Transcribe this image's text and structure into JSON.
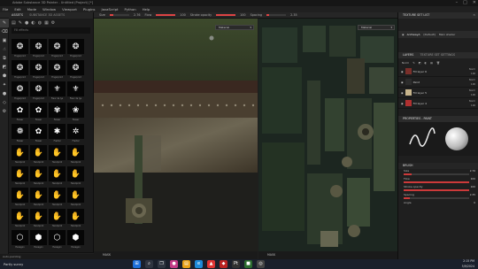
{
  "window": {
    "title": "Adobe Substance 3D Painter - Untitled (Project) [*]"
  },
  "menu": [
    "File",
    "Edit",
    "Mode",
    "Window",
    "Viewport",
    "Plugins",
    "JavaScript",
    "Python",
    "Help"
  ],
  "toolbar": {
    "size_label": "Size",
    "size_value": "2.76",
    "flow_label": "Flow",
    "flow_value": "100",
    "stroke_label": "Stroke opacity",
    "stroke_value": "100",
    "spacing_label": "Spacing",
    "spacing_value": "2.35"
  },
  "left_tools": [
    "paint",
    "eraser",
    "projection",
    "smudge",
    "clone",
    "fill",
    "polygon",
    "picker",
    "material",
    "geometry",
    "bake"
  ],
  "assets": {
    "tab_active": "ASSETS",
    "tab_other": "SUBSTANCE 3D ASSETS",
    "search_placeholder": "Fill effects",
    "items": [
      {
        "label": "Fingerprint",
        "glyph": "❂"
      },
      {
        "label": "Fingerprint",
        "glyph": "❂"
      },
      {
        "label": "Fingerprint",
        "glyph": "❂"
      },
      {
        "label": "Fingerprint",
        "glyph": "❂"
      },
      {
        "label": "Fingerprint",
        "glyph": "❂"
      },
      {
        "label": "Fingerprint",
        "glyph": "❂"
      },
      {
        "label": "Fingerprint",
        "glyph": "❂"
      },
      {
        "label": "Fingerprint",
        "glyph": "❂"
      },
      {
        "label": "Fingerprint",
        "glyph": "❂"
      },
      {
        "label": "Fingerprint",
        "glyph": "❂"
      },
      {
        "label": "Fleur de lys",
        "glyph": "⚜"
      },
      {
        "label": "Fleur de lys",
        "glyph": "⚜"
      },
      {
        "label": "Flower",
        "glyph": "✿"
      },
      {
        "label": "Flower",
        "glyph": "✿"
      },
      {
        "label": "Flower",
        "glyph": "✾"
      },
      {
        "label": "Flower",
        "glyph": "❀"
      },
      {
        "label": "Flower",
        "glyph": "❁"
      },
      {
        "label": "Flower",
        "glyph": "✿"
      },
      {
        "label": "Fractal",
        "glyph": "✱"
      },
      {
        "label": "Fractal",
        "glyph": "✲"
      },
      {
        "label": "Handprint",
        "glyph": "✋"
      },
      {
        "label": "Handprint",
        "glyph": "✋"
      },
      {
        "label": "Handprint",
        "glyph": "✋"
      },
      {
        "label": "Handprint",
        "glyph": "✋"
      },
      {
        "label": "Handprint",
        "glyph": "✋"
      },
      {
        "label": "Handprint",
        "glyph": "✋"
      },
      {
        "label": "Handprint",
        "glyph": "✋"
      },
      {
        "label": "Handprint",
        "glyph": "✋"
      },
      {
        "label": "Handprint",
        "glyph": "✋"
      },
      {
        "label": "Handprint",
        "glyph": "✋"
      },
      {
        "label": "Handprint",
        "glyph": "✋"
      },
      {
        "label": "Handprint",
        "glyph": "✋"
      },
      {
        "label": "Handprint",
        "glyph": "✋"
      },
      {
        "label": "Handprint",
        "glyph": "✋"
      },
      {
        "label": "Handprint",
        "glyph": "✋"
      },
      {
        "label": "Handprint",
        "glyph": "✋"
      },
      {
        "label": "Hexagon",
        "glyph": "⬡"
      },
      {
        "label": "Hexagon",
        "glyph": "⬢"
      },
      {
        "label": "Hexagon",
        "glyph": "⬡"
      },
      {
        "label": "Hexagon",
        "glyph": "⬢"
      }
    ]
  },
  "viewport3d": {
    "dropdown": "Material",
    "footer": "MASK"
  },
  "viewport2d": {
    "dropdown": "Material",
    "footer": "MASK"
  },
  "texture_set_list": {
    "title": "TEXTURE SET LIST",
    "item": "ArchwayA",
    "item_sub": "[Default]",
    "item_right": "Main shader"
  },
  "layers": {
    "tab_layers": "LAYERS",
    "tab_settings": "TEXTURE SET SETTINGS",
    "blend_default": "Norm",
    "items": [
      {
        "name": "Fill layer 6",
        "blend": "Norm",
        "opacity": "100",
        "color": "#7a2f2a"
      },
      {
        "name": "Paint",
        "blend": "Norm",
        "opacity": "100",
        "color": "#2c2c2c"
      },
      {
        "name": "Fill layer 5",
        "blend": "Norm",
        "opacity": "100",
        "color": "#c8b58c"
      },
      {
        "name": "Fill layer 4",
        "blend": "Norm",
        "opacity": "100",
        "color": "#b03030"
      }
    ]
  },
  "properties": {
    "title": "PROPERTIES - PAINT",
    "section_brush": "BRUSH",
    "size_label": "Size",
    "size_value": "2.76",
    "size_fill": 0.12,
    "flow_label": "Flow",
    "flow_value": "100",
    "flow_fill": 1.0,
    "stroke_label": "Stroke opacity",
    "stroke_value": "100",
    "stroke_fill": 1.0,
    "spacing_label": "Spacing",
    "spacing_value": "2.35",
    "spacing_fill": 0.1,
    "angle_label": "Angle",
    "angle_value": "0"
  },
  "status": {
    "text": "Auto-painting"
  },
  "taskbar": {
    "weather": "Partly sunny",
    "time": "2:15 PM",
    "date": "5/9/2024"
  },
  "colors": {
    "accent": "#d43b3b",
    "panel": "#1f1f1f"
  }
}
